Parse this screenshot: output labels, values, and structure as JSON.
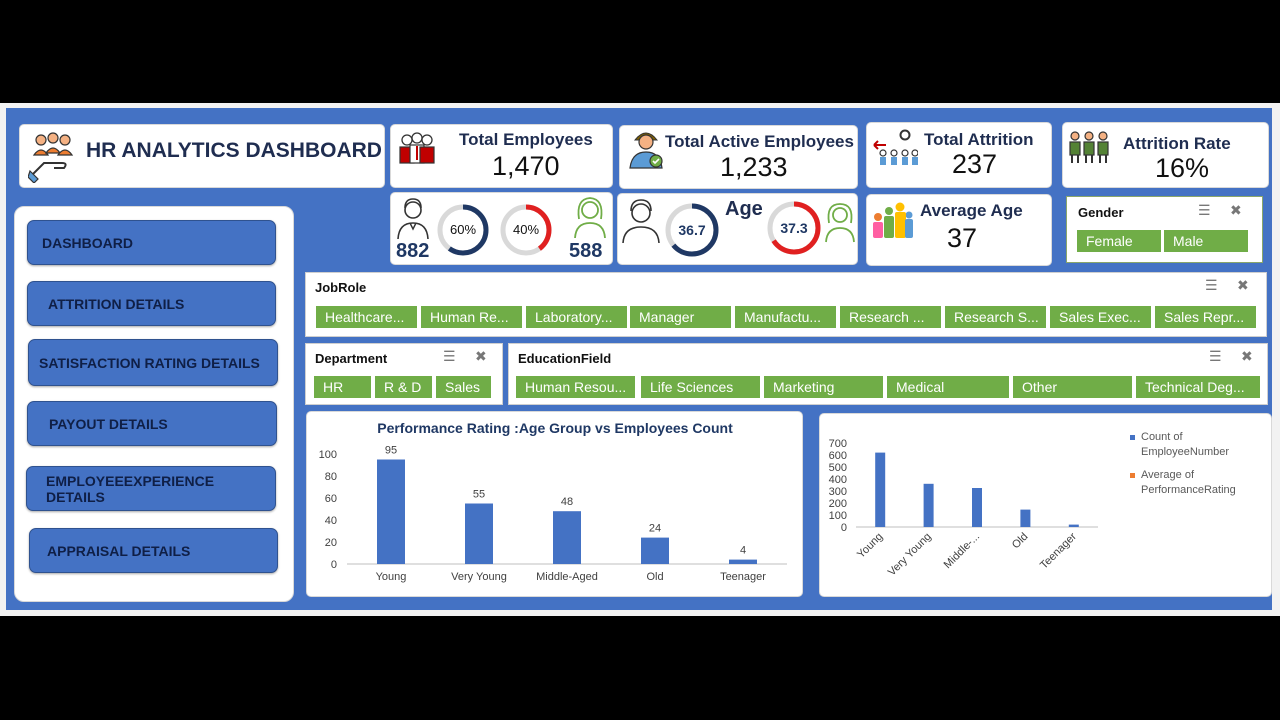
{
  "header": {
    "title": "HR ANALYTICS DASHBOARD"
  },
  "kpis": {
    "total_employees": {
      "label": "Total Employees",
      "value": "1,470"
    },
    "total_active": {
      "label": "Total Active Employees",
      "value": "1,233"
    },
    "total_attrition": {
      "label": "Total Attrition",
      "value": "237"
    },
    "attrition_rate": {
      "label": "Attrition Rate",
      "value": "16%"
    },
    "average_age": {
      "label": "Average Age",
      "value": "37"
    }
  },
  "gender_split": {
    "male_count": "882",
    "male_pct": "60%",
    "female_pct": "40%",
    "female_count": "588",
    "male_fraction": 0.6,
    "female_fraction": 0.4
  },
  "age_card": {
    "label": "Age",
    "male_avg": "36.7",
    "female_avg": "37.3",
    "male_fraction": 0.64,
    "female_fraction": 0.66
  },
  "colors": {
    "accent": "#4472c4",
    "slicer_green": "#70ad47",
    "ring_navy": "#1f3864",
    "ring_red": "#e02020",
    "female_green": "#70ad47"
  },
  "nav": {
    "items": [
      {
        "label": "DASHBOARD"
      },
      {
        "label": "ATTRITION DETAILS"
      },
      {
        "label": "SATISFACTION RATING DETAILS"
      },
      {
        "label": "PAYOUT DETAILS"
      },
      {
        "label": "EMPLOYEEEXPERIENCE DETAILS"
      },
      {
        "label": "APPRAISAL DETAILS"
      }
    ]
  },
  "slicers": {
    "gender": {
      "title": "Gender",
      "items": [
        "Female",
        "Male"
      ]
    },
    "jobrole": {
      "title": "JobRole",
      "items": [
        "Healthcare...",
        "Human Re...",
        "Laboratory...",
        "Manager",
        "Manufactu...",
        "Research ...",
        "Research S...",
        "Sales Exec...",
        "Sales Repr..."
      ]
    },
    "department": {
      "title": "Department",
      "items": [
        "HR",
        "R & D",
        "Sales"
      ]
    },
    "education": {
      "title": "EducationField",
      "items": [
        "Human Resou...",
        "Life Sciences",
        "Marketing",
        "Medical",
        "Other",
        "Technical Deg..."
      ]
    }
  },
  "chart_data": [
    {
      "type": "bar",
      "title": "Performance Rating :Age Group vs Employees Count",
      "categories": [
        "Young",
        "Very Young",
        "Middle-Aged",
        "Old",
        "Teenager"
      ],
      "values": [
        95,
        55,
        48,
        24,
        4
      ],
      "ylim": [
        0,
        100
      ],
      "yticks": [
        "0",
        "20",
        "40",
        "60",
        "80",
        "100"
      ],
      "xlabel": "",
      "ylabel": "",
      "grid": false,
      "data_labels": true
    },
    {
      "type": "bar",
      "categories": [
        "Young",
        "Very Young",
        "Middle-...",
        "Old",
        "Teenager"
      ],
      "series": [
        {
          "name": "Count of EmployeeNumber",
          "values": [
            620,
            360,
            325,
            145,
            20
          ],
          "color": "#4472c4"
        },
        {
          "name": "Average of PerformanceRating",
          "values": [
            3,
            3,
            3,
            3,
            3
          ],
          "color": "#ed7d31"
        }
      ],
      "legend_lines": [
        [
          "Count of",
          "EmployeeNumber"
        ],
        [
          "Average of",
          "PerformanceRating"
        ]
      ],
      "ylim": [
        0,
        700
      ],
      "yticks": [
        "0",
        "100",
        "200",
        "300",
        "400",
        "500",
        "600",
        "700"
      ],
      "legend_position": "right",
      "grid": false
    }
  ]
}
